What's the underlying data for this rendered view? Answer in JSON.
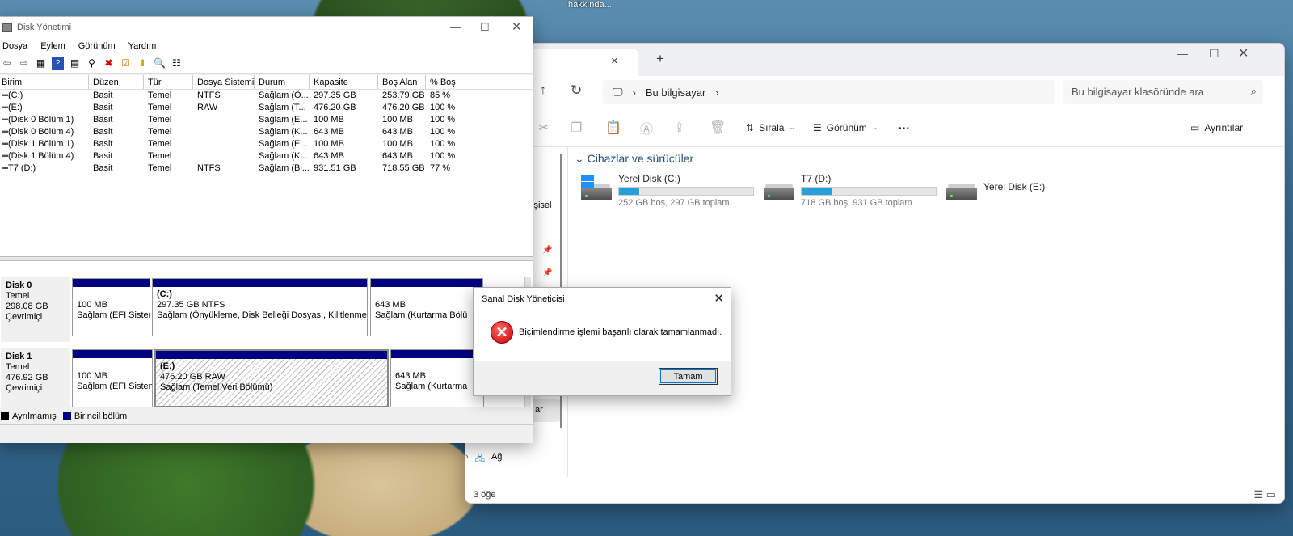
{
  "wallpaper": {
    "caption": "hakkında..."
  },
  "explorer": {
    "close_icon": "×",
    "new_tab_icon": "+",
    "breadcrumb": [
      "Bu bilgisayar"
    ],
    "search_placeholder": "Bu bilgisayar klasöründe ara",
    "sort_label": "Sırala",
    "view_label": "Görünüm",
    "more_label": "···",
    "details_label": "Ayrıntılar",
    "section_title": "Cihazlar ve sürücüler",
    "sidebar_fragments": {
      "a": "işisel",
      "b": "ar",
      "network": "Ağ"
    },
    "drives": [
      {
        "name": "Yerel Disk (C:)",
        "info": "252 GB boş, 297 GB toplam",
        "used_fraction": 0.15,
        "icon": "windows-drive"
      },
      {
        "name": "T7 (D:)",
        "info": "718 GB boş, 931 GB toplam",
        "used_fraction": 0.23,
        "icon": "drive"
      },
      {
        "name": "Yerel Disk (E:)",
        "info": "",
        "used_fraction": null,
        "icon": "drive"
      }
    ],
    "status": "3 öğe"
  },
  "disk_mgmt": {
    "title": "Disk Yönetimi",
    "menu": [
      "Dosya",
      "Eylem",
      "Görünüm",
      "Yardım"
    ],
    "columns": [
      "Birim",
      "Düzen",
      "Tür",
      "Dosya Sistemi",
      "Durum",
      "Kapasite",
      "Boş Alan",
      "% Boş"
    ],
    "rows": [
      [
        "(C:)",
        "Basit",
        "Temel",
        "NTFS",
        "Sağlam (Ö...",
        "297.35 GB",
        "253.79 GB",
        "85 %"
      ],
      [
        "(E:)",
        "Basit",
        "Temel",
        "RAW",
        "Sağlam (T...",
        "476.20 GB",
        "476.20 GB",
        "100 %"
      ],
      [
        "(Disk 0 Bölüm 1)",
        "Basit",
        "Temel",
        "",
        "Sağlam (E...",
        "100 MB",
        "100 MB",
        "100 %"
      ],
      [
        "(Disk 0 Bölüm 4)",
        "Basit",
        "Temel",
        "",
        "Sağlam (K...",
        "643 MB",
        "643 MB",
        "100 %"
      ],
      [
        "(Disk 1 Bölüm 1)",
        "Basit",
        "Temel",
        "",
        "Sağlam (E...",
        "100 MB",
        "100 MB",
        "100 %"
      ],
      [
        "(Disk 1 Bölüm 4)",
        "Basit",
        "Temel",
        "",
        "Sağlam (K...",
        "643 MB",
        "643 MB",
        "100 %"
      ],
      [
        "T7 (D:)",
        "Basit",
        "Temel",
        "NTFS",
        "Sağlam (Bi...",
        "931.51 GB",
        "718.55 GB",
        "77 %"
      ]
    ],
    "disks": [
      {
        "name": "Disk 0",
        "type": "Temel",
        "size": "298.08 GB",
        "state": "Çevrimiçi",
        "parts": [
          {
            "l1": "",
            "l2": "100 MB",
            "l3": "Sağlam (EFI Sisten"
          },
          {
            "l1": "(C:)",
            "l2": "297.35 GB NTFS",
            "l3": "Sağlam (Önyükleme, Disk Belleği Dosyası, Kilitlenme Bi"
          },
          {
            "l1": "",
            "l2": "643 MB",
            "l3": "Sağlam (Kurtarma Bölü"
          }
        ]
      },
      {
        "name": "Disk 1",
        "type": "Temel",
        "size": "476.92 GB",
        "state": "Çevrimiçi",
        "parts": [
          {
            "l1": "",
            "l2": "100 MB",
            "l3": "Sağlam (EFI Sisten"
          },
          {
            "l1": "(E:)",
            "l2": "476.20 GB RAW",
            "l3": "Sağlam (Temel Veri Bölümü)"
          },
          {
            "l1": "",
            "l2": "643 MB",
            "l3": "Sağlam (Kurtarma"
          }
        ]
      }
    ],
    "legend": {
      "unallocated": "Ayrılmamış",
      "primary": "Birincil bölüm"
    }
  },
  "dialog": {
    "title": "Sanal Disk Yöneticisi",
    "message": "Biçimlendirme işlemi başarılı olarak tamamlanmadı.",
    "ok_label": "Tamam"
  }
}
